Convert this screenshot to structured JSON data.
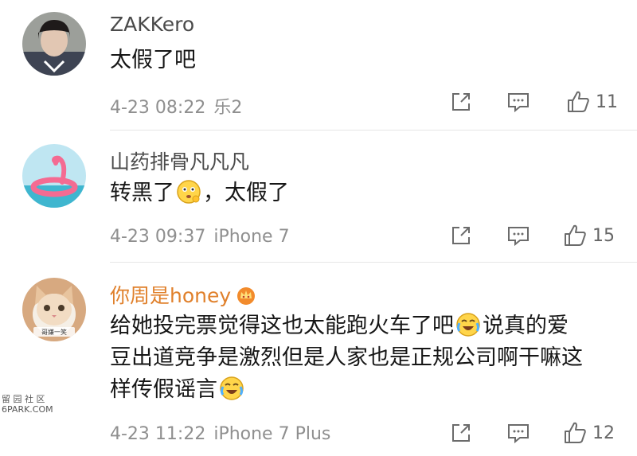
{
  "comments": [
    {
      "username": "ZAKKero",
      "text": "太假了吧",
      "date": "4-23 08:22",
      "client": "乐2",
      "likes": "11"
    },
    {
      "username": "山药排骨凡凡凡",
      "text_before": "转黑了",
      "text_after": "，太假了",
      "emoji_icon": "thinking-emoji-icon",
      "date": "4-23 09:37",
      "client": "iPhone 7",
      "likes": "15"
    },
    {
      "username": "你周是honey",
      "line1": "给她投完票觉得这也太能跑火车了吧",
      "line1_tail": "说真的爱",
      "line2": "豆出道竞争是激烈但是人家也是正规公司啊干嘛这",
      "line3": "样传假谣言",
      "emoji_icon": "laugh-cry-emoji-icon",
      "badge_icon": "crown-badge-icon",
      "avatar_caption": "哥嫌一笑",
      "date": "4-23 11:22",
      "client": "iPhone 7 Plus",
      "likes": "12"
    }
  ],
  "watermark": {
    "line1": "留 园 社 区",
    "line2": "6PARK.COM"
  },
  "colors": {
    "vip_name": "#e0802b",
    "meta": "#8f8f8f",
    "icon": "#6b6b6b"
  }
}
